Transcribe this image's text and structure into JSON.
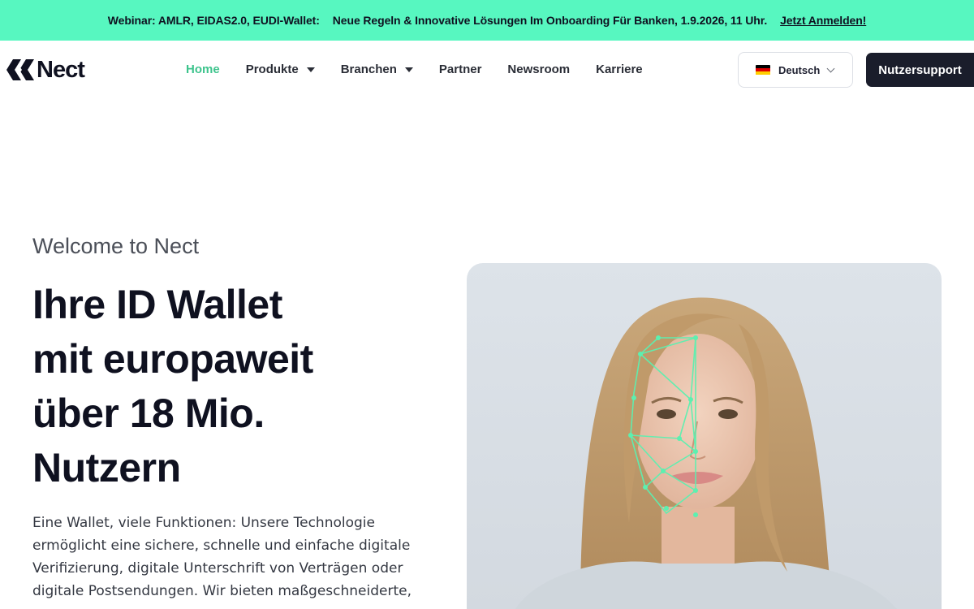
{
  "banner": {
    "event": "Webinar: AMLR, EIDAS2.0, EUDI-Wallet:",
    "text": "Neue Regeln & Innovative Lösungen Im Onboarding Für Banken, 1.9.2026, 11 Uhr.",
    "link": "Jetzt Anmelden!"
  },
  "header": {
    "logo_text": "Nect",
    "nav": [
      {
        "label": "Home",
        "active": true
      },
      {
        "label": "Produkte",
        "dropdown": true
      },
      {
        "label": "Branchen",
        "dropdown": true
      },
      {
        "label": "Partner"
      },
      {
        "label": "Newsroom"
      },
      {
        "label": "Karriere"
      }
    ],
    "language": "Deutsch",
    "support_button": "Nutzersupport"
  },
  "hero": {
    "eyebrow": "Welcome to Nect",
    "headline_lines": [
      "Ihre ID Wallet",
      "mit europaweit",
      "über 18 Mio.",
      "Nutzern"
    ],
    "body": "Eine Wallet, viele Funktionen: Unsere Technologie ermöglicht eine sichere, schnelle und einfache digitale Verifizierung, digitale Unterschrift von Verträgen oder digitale Postsendungen. Wir bieten maßgeschneiderte,"
  },
  "colors": {
    "banner_bg": "#57f7c0",
    "accent_green": "#3ec48d",
    "dark": "#1a1d2b",
    "face_mesh": "#5cf0b0"
  }
}
